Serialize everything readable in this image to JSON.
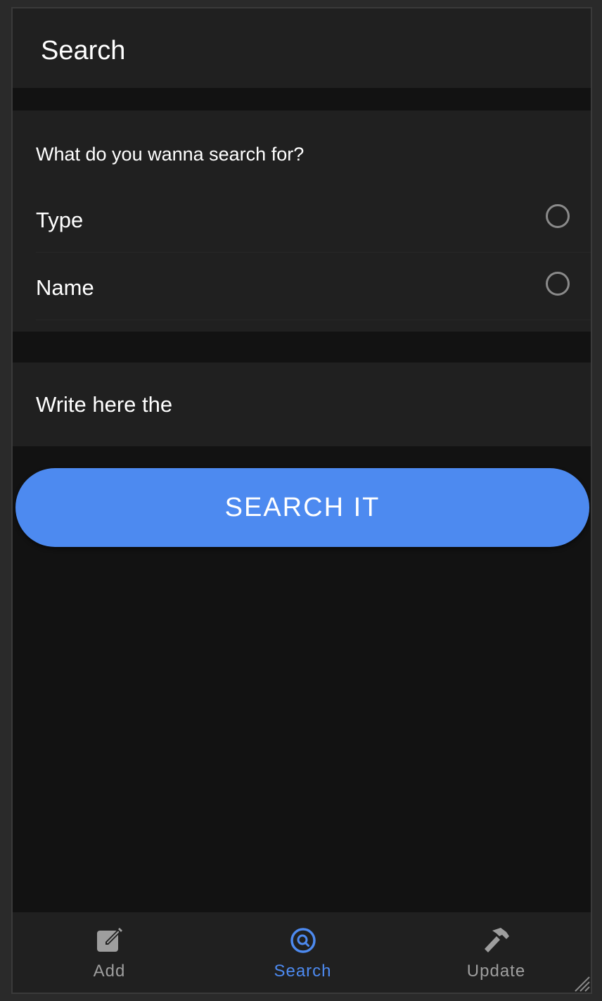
{
  "header": {
    "title": "Search"
  },
  "search_options": {
    "question": "What do you wanna search for?",
    "options": [
      {
        "label": "Type",
        "selected": false
      },
      {
        "label": "Name",
        "selected": false
      }
    ]
  },
  "search_field": {
    "placeholder": "Write here the",
    "value": ""
  },
  "search_button": {
    "label": "SEARCH IT"
  },
  "tabbar": {
    "tabs": [
      {
        "label": "Add",
        "icon": "edit-icon",
        "active": false
      },
      {
        "label": "Search",
        "icon": "search-circle-icon",
        "active": true
      },
      {
        "label": "Update",
        "icon": "hammer-icon",
        "active": false
      }
    ]
  },
  "colors": {
    "accent": "#4d8af0",
    "background": "#121212",
    "surface": "#202020",
    "inactive": "#9e9e9e"
  }
}
